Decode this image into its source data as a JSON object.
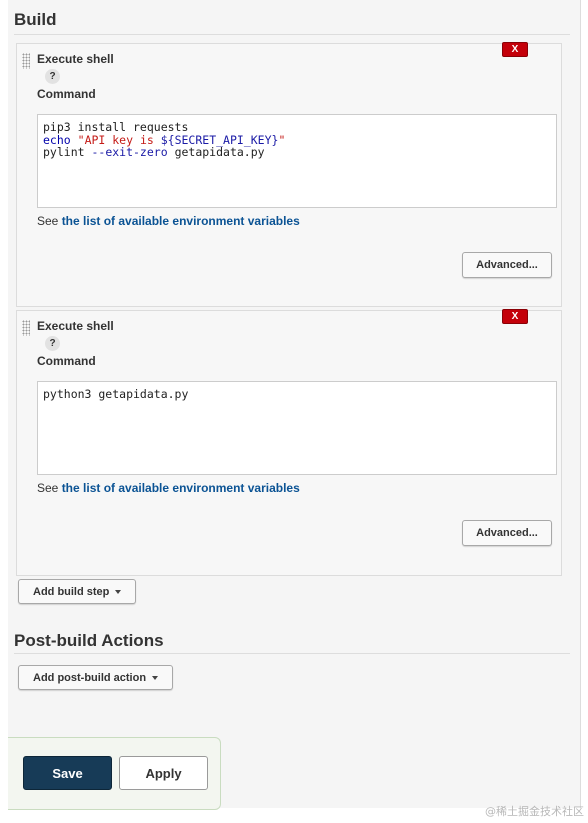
{
  "build": {
    "title": "Build",
    "steps": [
      {
        "title": "Execute shell",
        "help": "?",
        "delete_label": "X",
        "command_label": "Command",
        "code_lines": [
          [
            {
              "t": "pip3 install requests",
              "c": ""
            }
          ],
          [
            {
              "t": "echo",
              "c": "kw"
            },
            {
              "t": " ",
              "c": ""
            },
            {
              "t": "\"API key is ",
              "c": "str"
            },
            {
              "t": "${SECRET_API_KEY}",
              "c": "var"
            },
            {
              "t": "\"",
              "c": "str"
            }
          ],
          [
            {
              "t": "pylint ",
              "c": ""
            },
            {
              "t": "--exit-zero",
              "c": "var"
            },
            {
              "t": " getapidata.py",
              "c": ""
            }
          ]
        ],
        "env_prefix": "See ",
        "env_link": "the list of available environment variables",
        "advanced_label": "Advanced..."
      },
      {
        "title": "Execute shell",
        "help": "?",
        "delete_label": "X",
        "command_label": "Command",
        "code_lines": [
          [
            {
              "t": "python3 getapidata.py",
              "c": ""
            }
          ]
        ],
        "env_prefix": "See ",
        "env_link": "the list of available environment variables",
        "advanced_label": "Advanced..."
      }
    ],
    "add_step_label": "Add build step"
  },
  "post_build": {
    "title": "Post-build Actions",
    "add_action_label": "Add post-build action"
  },
  "footer": {
    "save_label": "Save",
    "apply_label": "Apply"
  },
  "watermark": "@稀土掘金技术社区"
}
